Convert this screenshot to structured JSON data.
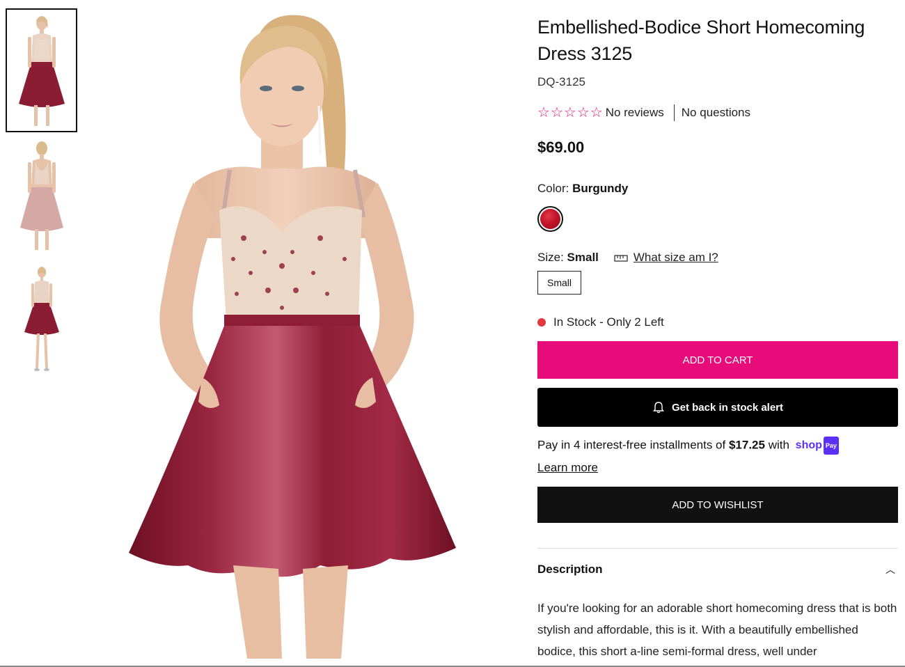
{
  "product": {
    "title": "Embellished-Bodice Short Homecoming Dress 3125",
    "sku": "DQ-3125",
    "reviews_text": "No reviews",
    "questions_text": "No questions",
    "rating": 0,
    "rating_max": 5,
    "price": "$69.00"
  },
  "color": {
    "label": "Color:",
    "value": "Burgundy",
    "swatch_color": "#c4132a"
  },
  "size": {
    "label": "Size:",
    "value": "Small",
    "guide_link": "What size am I?",
    "options": [
      "Small"
    ]
  },
  "stock": {
    "text": "In Stock - Only 2 Left",
    "dot_color": "#e0393e"
  },
  "buttons": {
    "add_to_cart": "ADD TO CART",
    "stock_alert": "Get back in stock alert",
    "add_to_wishlist": "ADD TO WISHLIST"
  },
  "shoppay": {
    "text_prefix": "Pay in 4 interest-free installments of ",
    "amount": "$17.25",
    "text_suffix": " with",
    "brand_word": "shop",
    "brand_badge": "Pay",
    "learn_more": "Learn more"
  },
  "description": {
    "heading": "Description",
    "body": "If you're looking for an adorable short homecoming dress that is both stylish and affordable, this is it. With a beautifully embellished bodice, this short a-line semi-formal dress, well under"
  },
  "thumbnails": [
    {
      "name": "front-view",
      "dress_color": "#8a1c33"
    },
    {
      "name": "back-view",
      "dress_color": "#d4a8a4"
    },
    {
      "name": "full-length-view",
      "dress_color": "#8a1c33"
    }
  ],
  "colors": {
    "accent_pink": "#e80c7a",
    "star_pink": "#e6177a",
    "shoppay_purple": "#5a31f4"
  }
}
